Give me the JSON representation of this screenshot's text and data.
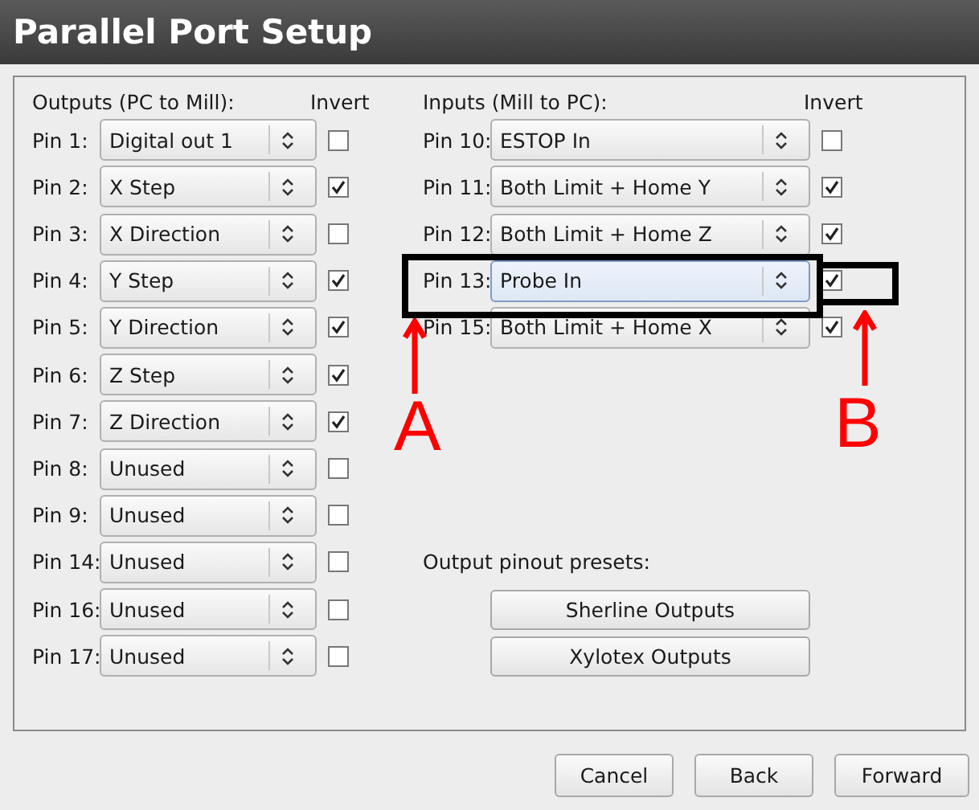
{
  "window": {
    "title": "Parallel Port Setup"
  },
  "outputs": {
    "heading": "Outputs (PC to Mill):",
    "invert_heading": "Invert",
    "pins": [
      {
        "label": "Pin 1:",
        "value": "Digital out 1",
        "invert": false,
        "focused": false
      },
      {
        "label": "Pin 2:",
        "value": "X Step",
        "invert": true,
        "focused": false
      },
      {
        "label": "Pin 3:",
        "value": "X Direction",
        "invert": false,
        "focused": false
      },
      {
        "label": "Pin 4:",
        "value": "Y Step",
        "invert": true,
        "focused": false
      },
      {
        "label": "Pin 5:",
        "value": "Y Direction",
        "invert": true,
        "focused": false
      },
      {
        "label": "Pin 6:",
        "value": "Z Step",
        "invert": true,
        "focused": false
      },
      {
        "label": "Pin 7:",
        "value": "Z Direction",
        "invert": true,
        "focused": false
      },
      {
        "label": "Pin 8:",
        "value": "Unused",
        "invert": false,
        "focused": false
      },
      {
        "label": "Pin 9:",
        "value": "Unused",
        "invert": false,
        "focused": false
      },
      {
        "label": "Pin 14:",
        "value": "Unused",
        "invert": false,
        "focused": false
      },
      {
        "label": "Pin 16:",
        "value": "Unused",
        "invert": false,
        "focused": false
      },
      {
        "label": "Pin 17:",
        "value": "Unused",
        "invert": false,
        "focused": false
      }
    ]
  },
  "inputs": {
    "heading": "Inputs (Mill to PC):",
    "invert_heading": "Invert",
    "pins": [
      {
        "label": "Pin 10:",
        "value": "ESTOP In",
        "invert": false,
        "focused": false
      },
      {
        "label": "Pin 11:",
        "value": "Both Limit + Home Y",
        "invert": true,
        "focused": false
      },
      {
        "label": "Pin 12:",
        "value": "Both Limit + Home Z",
        "invert": true,
        "focused": false
      },
      {
        "label": "Pin 13:",
        "value": "Probe In",
        "invert": true,
        "focused": true
      },
      {
        "label": "Pin 15:",
        "value": "Both Limit + Home X",
        "invert": true,
        "focused": false
      }
    ]
  },
  "presets": {
    "heading": "Output pinout presets:",
    "buttons": [
      "Sherline Outputs",
      "Xylotex Outputs"
    ]
  },
  "buttons": [
    "Cancel",
    "Back",
    "Forward"
  ],
  "annotations": [
    {
      "kind": "box-arrow",
      "letter": "A"
    },
    {
      "kind": "box-arrow",
      "letter": "B"
    }
  ]
}
